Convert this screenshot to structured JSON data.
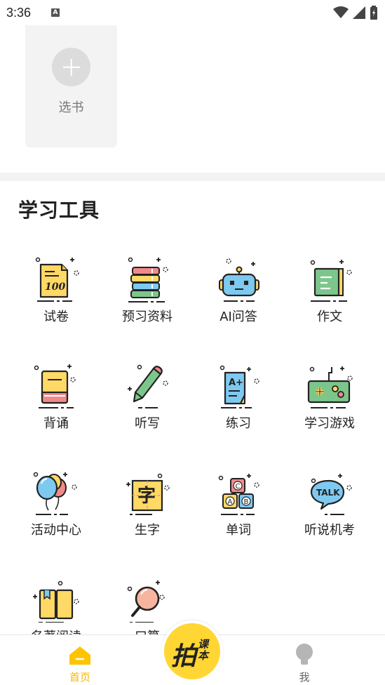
{
  "status_bar": {
    "time": "3:36",
    "notif": "A"
  },
  "book": {
    "label": "选书"
  },
  "section": {
    "title": "学习工具"
  },
  "tools": [
    {
      "label": "试卷",
      "icon": "exam-paper-icon"
    },
    {
      "label": "预习资料",
      "icon": "book-stack-icon"
    },
    {
      "label": "AI问答",
      "icon": "robot-icon"
    },
    {
      "label": "作文",
      "icon": "notebook-icon"
    },
    {
      "label": "背诵",
      "icon": "closed-book-icon"
    },
    {
      "label": "听写",
      "icon": "pencil-icon"
    },
    {
      "label": "练习",
      "icon": "a-plus-paper-icon"
    },
    {
      "label": "学习游戏",
      "icon": "gamepad-icon"
    },
    {
      "label": "活动中心",
      "icon": "balloons-icon"
    },
    {
      "label": "生字",
      "icon": "character-card-icon"
    },
    {
      "label": "单词",
      "icon": "abc-blocks-icon"
    },
    {
      "label": "听说机考",
      "icon": "talk-bubble-icon"
    },
    {
      "label": "名著阅读",
      "icon": "open-book-icon"
    },
    {
      "label": "口算",
      "icon": "magnifier-icon"
    }
  ],
  "nav": {
    "home": "首页",
    "camera_main": "拍",
    "camera_sub": "课本",
    "me": "我"
  },
  "colors": {
    "accent": "#ffc400",
    "home_active": "#f5b800"
  }
}
